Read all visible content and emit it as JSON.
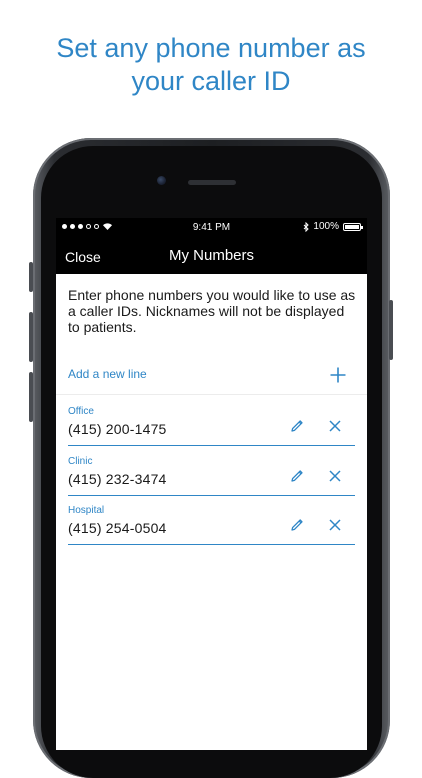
{
  "headline": {
    "line1": "Set any phone number as",
    "line2": "your caller ID"
  },
  "status_bar": {
    "time": "9:41 PM",
    "battery": "100%"
  },
  "nav": {
    "close_label": "Close",
    "title": "My Numbers"
  },
  "intro_text": "Enter phone numbers you would like to use as a caller IDs. Nicknames will not be displayed to patients.",
  "add_line_label": "Add a new line",
  "numbers": [
    {
      "nickname": "Office",
      "phone": "(415) 200-1475"
    },
    {
      "nickname": "Clinic",
      "phone": "(415) 232-3474"
    },
    {
      "nickname": "Hospital",
      "phone": "(415) 254-0504"
    }
  ],
  "icons": {
    "add": "plus-icon",
    "edit": "pencil-icon",
    "delete": "close-icon",
    "bluetooth": "bluetooth-icon",
    "wifi": "wifi-icon",
    "battery": "battery-icon"
  },
  "colors": {
    "accent": "#2F86C6",
    "nav_background": "#000000"
  }
}
